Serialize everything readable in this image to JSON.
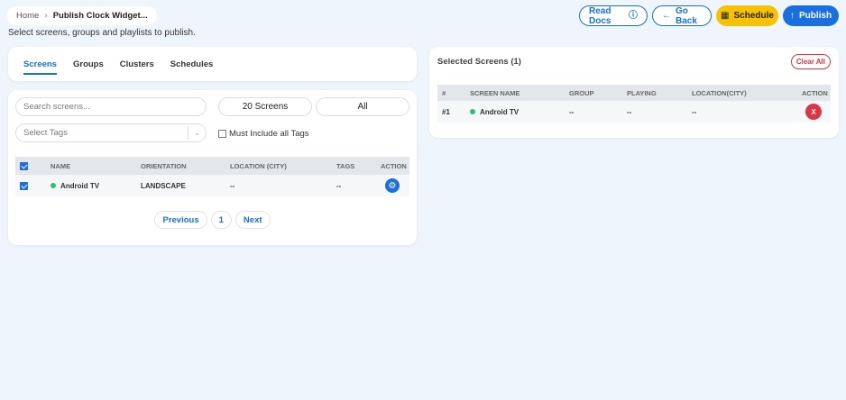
{
  "breadcrumb": {
    "home": "Home",
    "current": "Publish Clock Widget..."
  },
  "subtitle": "Select screens, groups and playlists to publish.",
  "header_buttons": {
    "read_docs": "Read Docs",
    "go_back": "Go Back",
    "schedule": "Schedule",
    "publish": "Publish"
  },
  "tabs": [
    "Screens",
    "Groups",
    "Clusters",
    "Schedules"
  ],
  "screens_panel": {
    "search_placeholder": "Search screens...",
    "count_label": "20 Screens",
    "filter_label": "All",
    "tags_placeholder": "Select Tags",
    "must_include_label": "Must Include all Tags",
    "columns": [
      "NAME",
      "ORIENTATION",
      "LOCATION (CITY)",
      "TAGS",
      "ACTION"
    ],
    "rows": [
      {
        "name": "Android TV",
        "orientation": "LANDSCAPE",
        "location": "--",
        "tags": "--"
      }
    ],
    "pagination": {
      "previous": "Previous",
      "page": "1",
      "next": "Next"
    }
  },
  "selected_panel": {
    "title": "Selected Screens (1)",
    "clear_all": "Clear All",
    "columns": [
      "#",
      "SCREEN NAME",
      "GROUP",
      "PLAYING",
      "LOCATION(CITY)",
      "ACTION"
    ],
    "rows": [
      {
        "index": "#1",
        "name": "Android TV",
        "group": "--",
        "playing": "--",
        "location": "--",
        "action": "X"
      }
    ]
  },
  "colors": {
    "background": "#eef5fd",
    "primary": "#1a6fe0",
    "schedule": "#f7c200",
    "danger": "#dc3545",
    "online": "#2fbf71"
  }
}
